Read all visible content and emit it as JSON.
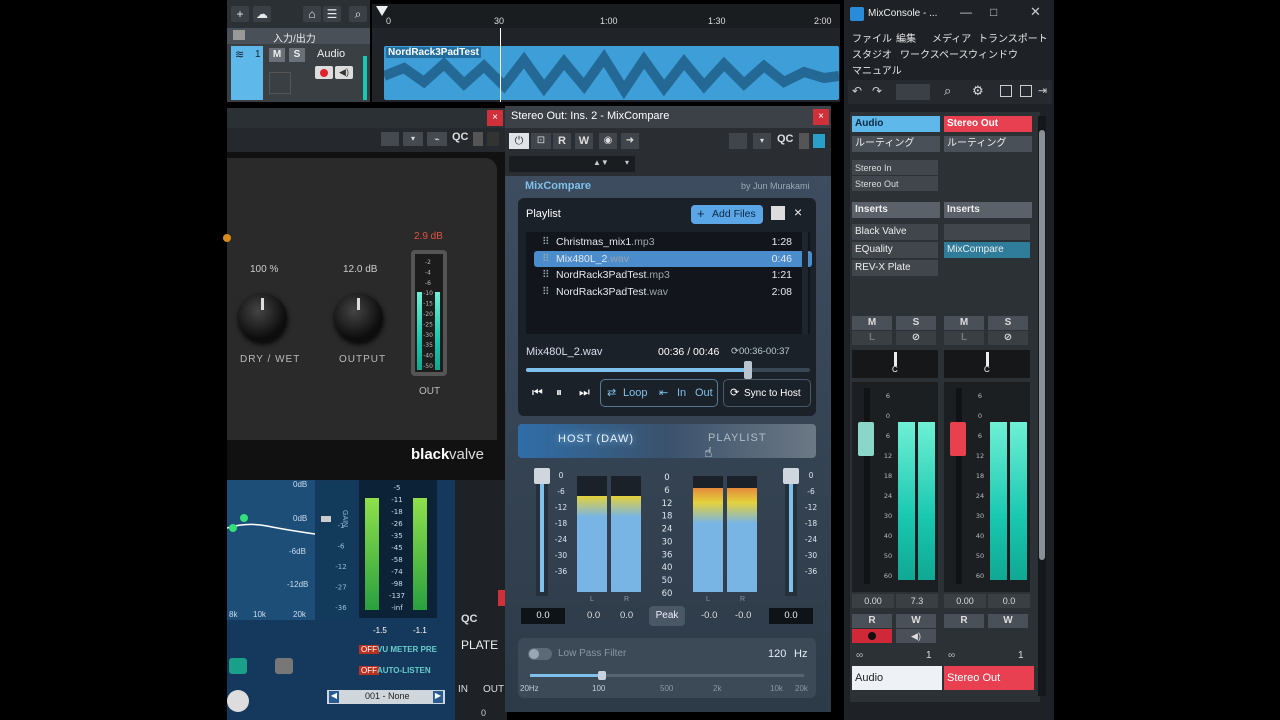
{
  "daw": {
    "ruler_ticks": [
      "0",
      "30",
      "1:00",
      "1:30",
      "2:00"
    ],
    "track": {
      "folder_label": "入力/出力",
      "number": "1",
      "mute_label": "M",
      "solo_label": "S",
      "name": "Audio",
      "clip_name": "NordRack3PadTest"
    }
  },
  "blackvalve": {
    "toolbar_qc": "QC",
    "peak_readout": "2.9 dB",
    "drywet_value": "100 %",
    "drywet_label": "DRY / WET",
    "output_value": "12.0 dB",
    "output_label": "OUTPUT",
    "meter_label": "OUT",
    "meter_scale": [
      "-2",
      "-4",
      "-6",
      "-10",
      "-15",
      "-20",
      "-25",
      "-30",
      "-35",
      "-40",
      "-50"
    ],
    "brand_bold": "black",
    "brand_light": "valve"
  },
  "eq_plugin": {
    "db_labels": [
      "0dB",
      "0dB",
      "-6dB",
      "-12dB"
    ],
    "freq_labels": [
      "8k",
      "10k",
      "20k"
    ],
    "gain_label": "GAIN",
    "scale": [
      "-1",
      "-6",
      "-12",
      "-27",
      "-36"
    ],
    "vu_scale": [
      "-5",
      "-11",
      "-18",
      "-26",
      "-35",
      "-45",
      "-58",
      "-74",
      "-98",
      "-137",
      "-inf"
    ],
    "vu_readouts": [
      "-1.5",
      "-1.1"
    ],
    "off1": "OFF",
    "vu_pre_label": "VU METER PRE",
    "off2": "OFF",
    "autolisten_label": "AUTO-LISTEN",
    "preset": "001 - None"
  },
  "plate_plugin": {
    "qc": "QC",
    "name": "PLATE",
    "in_label": "IN",
    "out_label": "OUT",
    "out_value": "0"
  },
  "mixcompare": {
    "window_title": "Stereo Out: Ins. 2 - MixCompare",
    "qc_label": "QC",
    "r_label": "R",
    "w_label": "W",
    "product_name": "MixCompare",
    "author": "by Jun Murakami",
    "playlist_title": "Playlist",
    "add_files_label": "Add Files",
    "playlist": [
      {
        "name": "Christmas_mix1",
        "ext": ".mp3",
        "duration": "1:28"
      },
      {
        "name": "Mix480L_2",
        "ext": ".wav",
        "duration": "0:46"
      },
      {
        "name": "NordRack3PadTest",
        "ext": ".mp3",
        "duration": "1:21"
      },
      {
        "name": "NordRack3PadTest",
        "ext": ".wav",
        "duration": "2:08"
      }
    ],
    "active_index": 1,
    "now_playing": "Mix480L_2.wav",
    "time_position": "00:36 / 00:46",
    "loop_range": "00:36-00:37",
    "progress": 0.78,
    "loop_label": "Loop",
    "in_label": "In",
    "out_label": "Out",
    "sync_label": "Sync to Host",
    "host_label": "HOST (DAW)",
    "playlist_switch_label": "PLAYLIST",
    "meter_scale": [
      "0",
      "6",
      "12",
      "18",
      "24",
      "30",
      "36",
      "40",
      "50",
      "60"
    ],
    "fader_scale": [
      "0",
      "-6",
      "-12",
      "-18",
      "-24",
      "-30",
      "-36"
    ],
    "left_fader_value": "0.0",
    "right_fader_value": "0.0",
    "meter_readouts": [
      "0.0",
      "0.0",
      "-0.0",
      "-0.0"
    ],
    "channel_lr": [
      "L",
      "R",
      "L",
      "R"
    ],
    "peak_label": "Peak",
    "lpf_label": "Low Pass Filter",
    "lpf_value": "120",
    "lpf_unit": "Hz",
    "lpf_scale": [
      "20Hz",
      "100",
      "500",
      "2k",
      "10k",
      "20k"
    ]
  },
  "mixconsole": {
    "title": "MixConsole - ...",
    "menu": [
      "ファイル",
      "編集",
      "メディア",
      "トランスポート",
      "スタジオ",
      "ワークスペース",
      "ウィンドウ",
      "マニュアル"
    ],
    "strips": [
      {
        "name": "Audio",
        "color": "#5fb8ea",
        "routing": "ルーティング",
        "io": [
          "Stereo In",
          "Stereo Out"
        ],
        "inserts_label": "Inserts",
        "inserts": [
          "Black Valve",
          "EQuality",
          "REV-X Plate"
        ],
        "mute": "M",
        "solo": "S",
        "listen": "L",
        "pan": "C",
        "fader_scale": [
          "6",
          "0",
          "6",
          "12",
          "18",
          "24",
          "30",
          "40",
          "50",
          "60"
        ],
        "readouts": [
          "0.00",
          "7.3"
        ],
        "read": "R",
        "write": "W",
        "channel_number": "1"
      },
      {
        "name": "Stereo Out",
        "color": "#e84050",
        "routing": "ルーティング",
        "inserts_label": "Inserts",
        "inserts": [
          "",
          "MixCompare"
        ],
        "mute": "M",
        "solo": "S",
        "listen": "L",
        "pan": "C",
        "fader_scale": [
          "6",
          "0",
          "6",
          "12",
          "18",
          "24",
          "30",
          "40",
          "50",
          "60"
        ],
        "readouts": [
          "0.00",
          "0.0"
        ],
        "read": "R",
        "write": "W",
        "channel_number": "1"
      }
    ]
  }
}
